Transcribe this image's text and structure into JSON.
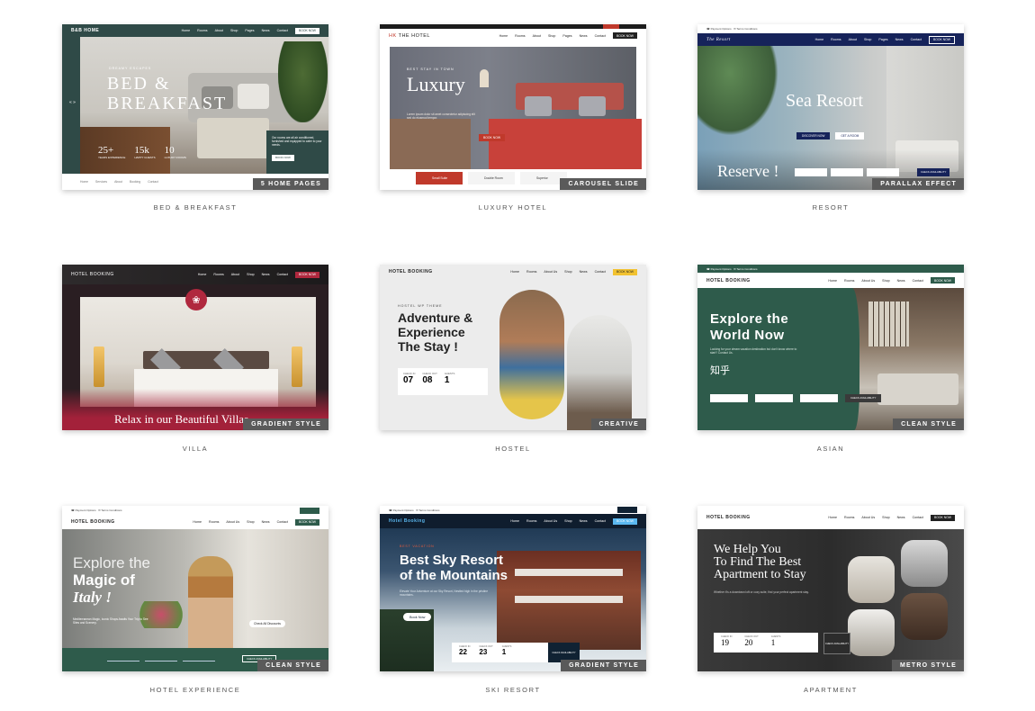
{
  "cards": [
    {
      "caption": "BED & BREAKFAST",
      "tag": "5 HOME PAGES",
      "title": "BED &",
      "title2": "BREAKFAST",
      "kicker": "DREAMY ESCAPES",
      "logo": "B&B HOME",
      "stats": [
        {
          "n": "25+",
          "l": "YEARS EXPERIENCE"
        },
        {
          "n": "15k",
          "l": "HAPPY GUESTS"
        },
        {
          "n": "10",
          "l": "LUXURY ROOMS"
        }
      ],
      "nav": [
        "Home",
        "Rooms",
        "About",
        "Shop",
        "Pages",
        "News",
        "Contact"
      ],
      "cta": "BOOK NOW",
      "side_text": "Our rooms are all air conditioned, furnished and equipped to cater to your needs.",
      "side_btn": "BOOK NOW"
    },
    {
      "caption": "LUXURY HOTEL",
      "tag": "CAROUSEL SLIDE",
      "title": "Luxury",
      "logo": "THE HOTEL",
      "kicker": "BEST STAY IN TOWN",
      "nav": [
        "Home",
        "Rooms",
        "About",
        "Shop",
        "Pages",
        "News",
        "Contact"
      ],
      "cta": "BOOK NOW",
      "btn": "BOOK NOW",
      "slides": [
        "Small Suite",
        "Double Room",
        "Superior"
      ]
    },
    {
      "caption": "RESORT",
      "tag": "PARALLAX EFFECT",
      "title": "Sea Resort",
      "subtitle": "Reserve !",
      "logo": "The Resort",
      "nav": [
        "Home",
        "Rooms",
        "About",
        "Shop",
        "Pages",
        "News",
        "Contact"
      ],
      "cta": "BOOK NOW",
      "btn1": "DISCOVER NOW",
      "btn2": "GET A ROOM",
      "btn3": "CHECK AVAILABILITY"
    },
    {
      "caption": "VILLA",
      "tag": "GRADIENT STYLE",
      "title": "Relax in our Beautiful Villas",
      "logo": "HOTEL BOOKING",
      "nav": [
        "Home",
        "Rooms",
        "About",
        "Shop",
        "News",
        "Contact"
      ],
      "cta": "BOOK NOW"
    },
    {
      "caption": "HOSTEL",
      "tag": "CREATIVE",
      "title": "Adventure &",
      "title2": "Experience",
      "title3": "The Stay !",
      "kicker": "HOSTEL WP THEME",
      "logo": "HOTEL BOOKING",
      "nav": [
        "Home",
        "Rooms",
        "About Us",
        "Shop",
        "News",
        "Contact"
      ],
      "cta": "BOOK NOW",
      "fields": [
        {
          "l": "CHECK IN",
          "v": "07"
        },
        {
          "l": "CHECK OUT",
          "v": "08"
        },
        {
          "l": "GUESTS",
          "v": "1"
        }
      ],
      "btn": "CHECK AVAILABILITY"
    },
    {
      "caption": "ASIAN",
      "tag": "CLEAN STYLE",
      "title": "Explore the",
      "title2": "World Now",
      "kanji": "知乎",
      "logo": "HOTEL BOOKING",
      "nav": [
        "Home",
        "Rooms",
        "About Us",
        "Shop",
        "News",
        "Contact"
      ],
      "cta": "BOOK NOW",
      "btn": "CHECK AVAILABILITY"
    },
    {
      "caption": "HOTEL EXPERIENCE",
      "tag": "CLEAN STYLE",
      "title": "Explore the",
      "title2": "Magic of",
      "title3": "Italy !",
      "logo": "HOTEL BOOKING",
      "nav": [
        "Home",
        "Rooms",
        "About Us",
        "Shop",
        "News",
        "Contact"
      ],
      "cta": "BOOK NOW",
      "pill": "Check All Discounts",
      "btn": "CHECK AVAILABILITY"
    },
    {
      "caption": "SKI RESORT",
      "tag": "GRADIENT STYLE",
      "title": "Best Sky Resort",
      "title2": "of the Mountains",
      "kicker": "BEST VACATION",
      "logo": "Hotel Booking",
      "nav": [
        "Home",
        "Rooms",
        "About Us",
        "Shop",
        "News",
        "Contact"
      ],
      "cta": "BOOK NOW",
      "btn": "Book Now",
      "fields": [
        {
          "l": "CHECK IN",
          "v": "22"
        },
        {
          "l": "CHECK OUT",
          "v": "23"
        },
        {
          "l": "GUESTS",
          "v": "1"
        }
      ],
      "btn2": "CHECK AVAILABILITY"
    },
    {
      "caption": "APARTMENT",
      "tag": "METRO STYLE",
      "title": "We Help You",
      "title2": "To Find The Best",
      "title3": "Apartment to Stay",
      "logo": "HOTEL BOOKING",
      "nav": [
        "Home",
        "Rooms",
        "About Us",
        "Shop",
        "News",
        "Contact"
      ],
      "cta": "BOOK NOW",
      "fields": [
        {
          "l": "CHECK IN",
          "v": "19"
        },
        {
          "l": "CHECK OUT",
          "v": "20"
        },
        {
          "l": "GUESTS",
          "v": "1"
        }
      ],
      "btn": "CHECK AVAILABILITY"
    }
  ]
}
